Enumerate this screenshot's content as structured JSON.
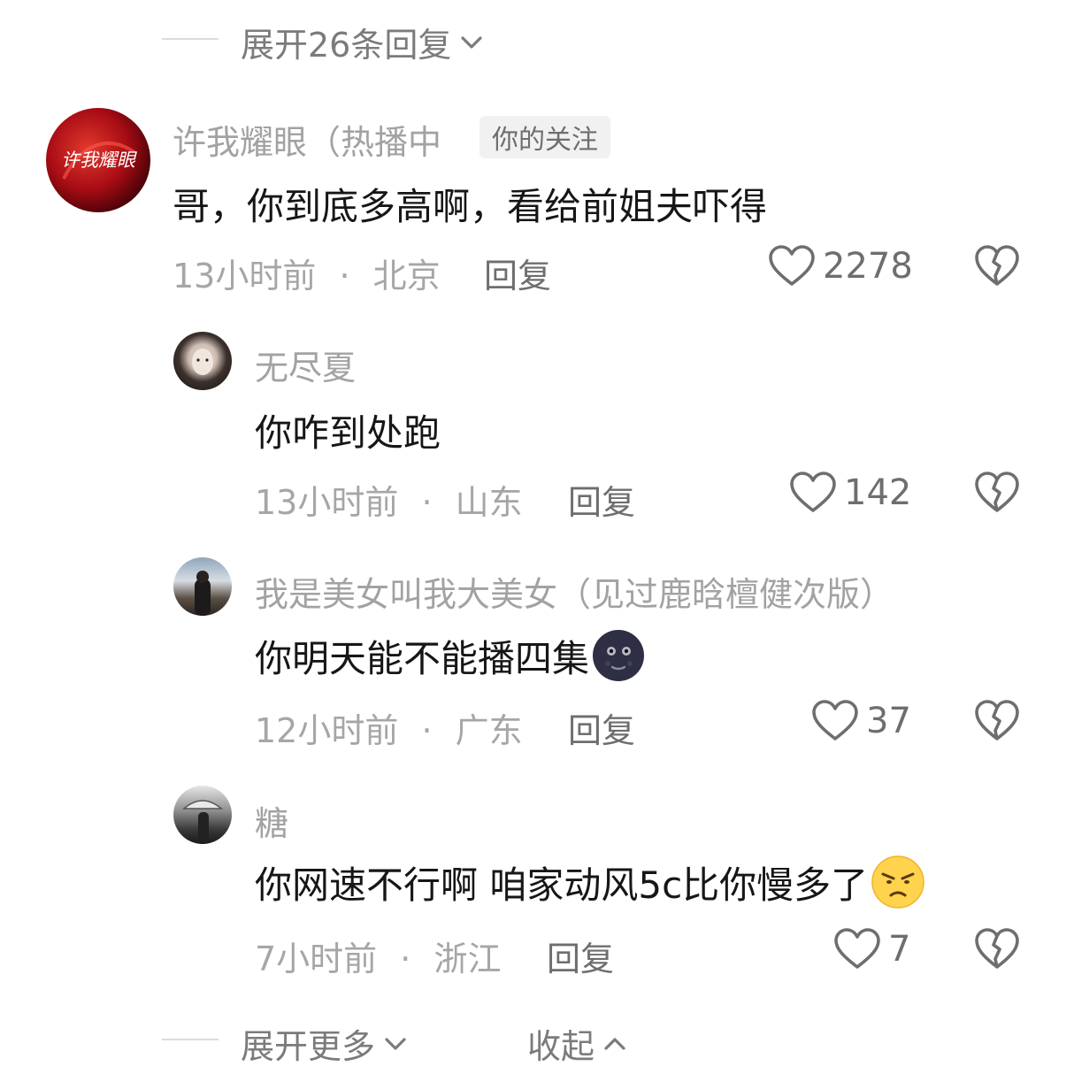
{
  "top": {
    "expand_label": "展开26条回复"
  },
  "comment": {
    "username": "许我耀眼（热播中",
    "tag": "你的关注",
    "avatar_text": "许我耀眼",
    "text": "哥，你到底多高啊，看给前姐夫吓得",
    "time": "13小时前",
    "dot": "·",
    "location": "北京",
    "reply_label": "回复",
    "likes": "2278"
  },
  "replies": [
    {
      "username": "无尽夏",
      "text": "你咋到处跑",
      "time": "13小时前",
      "dot": "·",
      "location": "山东",
      "reply_label": "回复",
      "likes": "142"
    },
    {
      "username": "我是美女叫我大美女（见过鹿晗檀健次版）",
      "text": "你明天能不能播四集",
      "time": "12小时前",
      "dot": "·",
      "location": "广东",
      "reply_label": "回复",
      "likes": "37"
    },
    {
      "username": "糖",
      "text": "你网速不行啊 咱家动风5c比你慢多了",
      "time": "7小时前",
      "dot": "·",
      "location": "浙江",
      "reply_label": "回复",
      "likes": "7"
    }
  ],
  "bottom": {
    "more_label": "展开更多",
    "collapse_label": "收起"
  },
  "colors": {
    "meta_gray": "#a6a6a6",
    "text_dark": "#161616",
    "avatar_red": "#c8141e"
  }
}
